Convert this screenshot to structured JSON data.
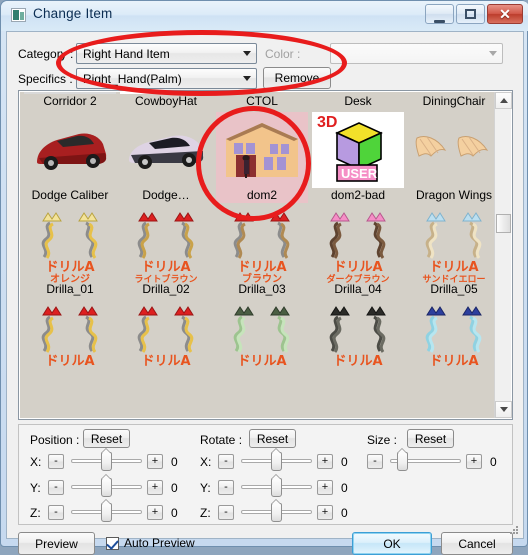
{
  "window": {
    "title": "Change Item",
    "icon": "app-icon",
    "buttons": {
      "minimize": "minimize-icon",
      "maximize": "maximize-icon",
      "close": "✕"
    }
  },
  "form": {
    "category_label": "Category :",
    "category_value": "Right Hand Item",
    "specifics_label": "Specifics :",
    "specifics_value": "Right_Hand(Palm)",
    "remove_label": "Remove",
    "color_label": "Color :",
    "color_value": ""
  },
  "grid": {
    "rows": [
      {
        "items": [
          {
            "caption": "Corridor 2",
            "art": "partial-white",
            "selected": false
          },
          {
            "caption": "CowboyHat",
            "art": "partial-white",
            "selected": false
          },
          {
            "caption": "CTOL",
            "art": "partial",
            "selected": false
          },
          {
            "caption": "Desk",
            "art": "partial",
            "selected": false
          },
          {
            "caption": "DiningChair",
            "art": "partial",
            "selected": false
          }
        ]
      },
      {
        "items": [
          {
            "caption": "Dodge Caliber",
            "art": "red-car",
            "selected": false
          },
          {
            "caption": "Dodge…",
            "art": "white-car",
            "selected": false
          },
          {
            "caption": "dom2",
            "art": "house",
            "selected": true
          },
          {
            "caption": "dom2-bad",
            "art": "cube-3d-user",
            "selected": false
          },
          {
            "caption": "Dragon Wings",
            "art": "wings",
            "selected": false
          }
        ]
      },
      {
        "items": [
          {
            "caption": "Drilla_01",
            "art": "drill-gold",
            "selected": false
          },
          {
            "caption": "Drilla_02",
            "art": "drill-red",
            "selected": false
          },
          {
            "caption": "Drilla_03",
            "art": "drill-brown",
            "selected": false
          },
          {
            "caption": "Drilla_04",
            "art": "drill-darkbrown",
            "selected": false
          },
          {
            "caption": "Drilla_05",
            "art": "drill-sand",
            "selected": false
          }
        ]
      },
      {
        "items": [
          {
            "caption": "",
            "art": "drill-gold2",
            "selected": false
          },
          {
            "caption": "",
            "art": "drill-red2",
            "selected": false
          },
          {
            "caption": "",
            "art": "drill-green",
            "selected": false
          },
          {
            "caption": "",
            "art": "drill-dark",
            "selected": false
          },
          {
            "caption": "",
            "art": "drill-blue",
            "selected": false
          }
        ]
      }
    ],
    "thumb_text": {
      "drill_title": "ドリルA",
      "drill_sub_01": "オレンジ",
      "drill_sub_02": "ライトブラウン",
      "drill_sub_03": "ブラウン",
      "drill_sub_04": "ダークブラウン",
      "drill_sub_05": "サンドイエロー",
      "badge_3d": "3D",
      "badge_user": "USER"
    },
    "scrollbar": {
      "up": "scroll-up-icon",
      "down": "scroll-down-icon"
    }
  },
  "transform": {
    "groups": [
      {
        "name": "Position :",
        "reset_label": "Reset",
        "axes": [
          {
            "label": "X:",
            "minus": "-",
            "plus": "+",
            "value": "0",
            "pos": 50
          },
          {
            "label": "Y:",
            "minus": "-",
            "plus": "+",
            "value": "0",
            "pos": 50
          },
          {
            "label": "Z:",
            "minus": "-",
            "plus": "+",
            "value": "0",
            "pos": 50
          }
        ]
      },
      {
        "name": "Rotate :",
        "reset_label": "Reset",
        "axes": [
          {
            "label": "X:",
            "minus": "-",
            "plus": "+",
            "value": "0",
            "pos": 50
          },
          {
            "label": "Y:",
            "minus": "-",
            "plus": "+",
            "value": "0",
            "pos": 50
          },
          {
            "label": "Z:",
            "minus": "-",
            "plus": "+",
            "value": "0",
            "pos": 50
          }
        ]
      },
      {
        "name": "Size :",
        "reset_label": "Reset",
        "axes": [
          {
            "label": "",
            "minus": "-",
            "plus": "+",
            "value": "0",
            "pos": 18
          }
        ]
      }
    ]
  },
  "footer": {
    "preview_label": "Preview",
    "auto_preview_label": "Auto Preview",
    "auto_preview_checked": true,
    "ok_label": "OK",
    "cancel_label": "Cancel"
  },
  "annotations": [
    {
      "name": "category-specifics-highlight"
    },
    {
      "name": "dom2-item-highlight"
    }
  ],
  "colors": {
    "annotation": "#e81c1c",
    "selection": "#e9c3c8",
    "accent": "#3c9fd6",
    "grid_bg": "#d4d0c8"
  }
}
